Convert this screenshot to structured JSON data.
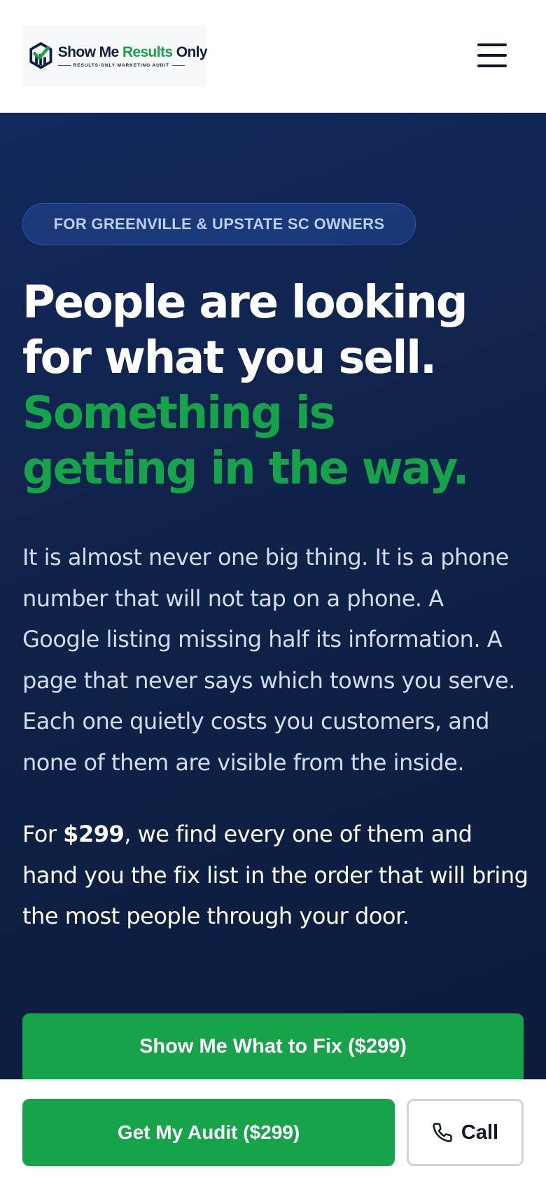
{
  "header": {
    "brand_part1": "Show Me ",
    "brand_part2": "Results",
    "brand_part3": " Only",
    "brand_tagline": "RESULTS-ONLY MARKETING AUDIT",
    "menu_icon": "hamburger-menu-icon"
  },
  "hero": {
    "badge": "FOR GREENVILLE & UPSTATE SC OWNERS",
    "headline_line1": "People are looking",
    "headline_line2": "for what you sell.",
    "headline_green_line1": "Something is",
    "headline_green_line2": "getting in the way.",
    "intro": "It is almost never one big thing. It is a phone number that will not tap on a phone. A Google listing missing half its information. A page that never says which towns you serve. Each one quietly costs you customers, and none of them are visible from the inside.",
    "offer_prefix": "For ",
    "offer_price": "$299",
    "offer_rest": ", we find every one of them and hand you the fix list in the order that will bring the most people through your door.",
    "cta_label": "Show Me What to Fix ($299)"
  },
  "bottom_bar": {
    "audit_label": "Get My Audit ($299)",
    "call_label": "Call",
    "call_icon": "phone-icon"
  },
  "colors": {
    "brand_green": "#17a34a",
    "navy": "#0f2249",
    "badge_text": "#b9cdf7"
  }
}
